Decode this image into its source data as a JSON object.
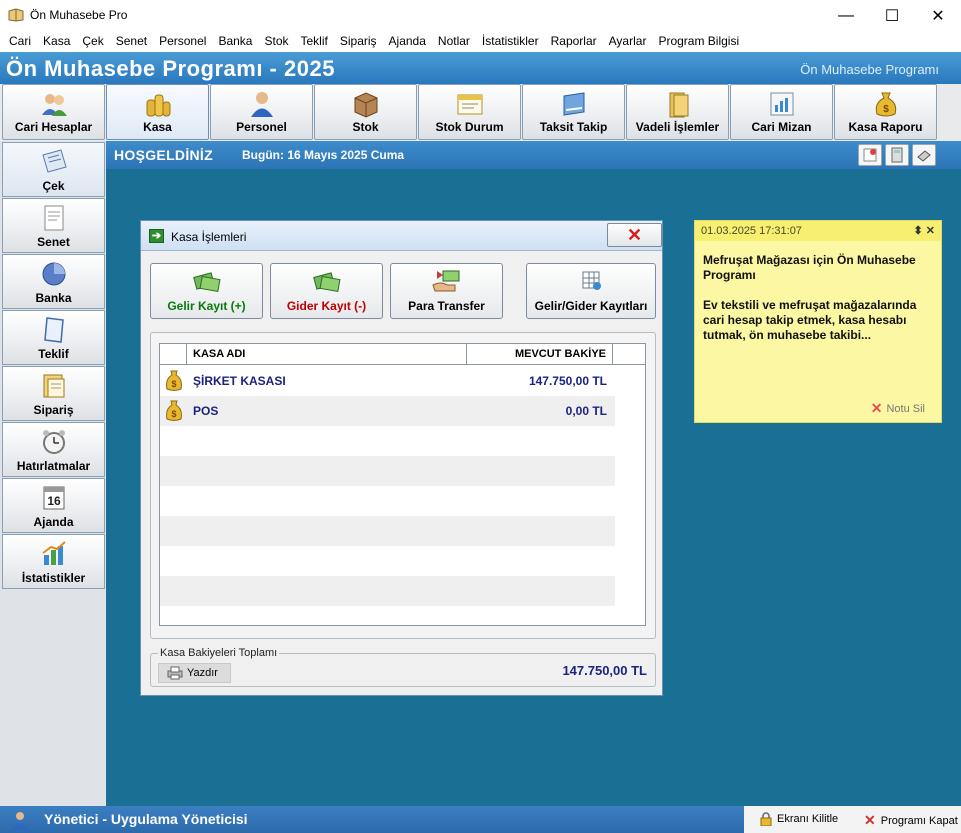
{
  "window": {
    "title": "Ön Muhasebe Pro",
    "controls": {
      "minimize": "—",
      "maximize": "☐",
      "close": "✕"
    }
  },
  "menu": [
    "Cari",
    "Kasa",
    "Çek",
    "Senet",
    "Personel",
    "Banka",
    "Stok",
    "Teklif",
    "Sipariş",
    "Ajanda",
    "Notlar",
    "İstatistikler",
    "Raporlar",
    "Ayarlar",
    "Program Bilgisi"
  ],
  "banner": {
    "title": "Ön Muhasebe Programı - 2025",
    "subtitle": "Ön Muhasebe Programı"
  },
  "toolbar": [
    {
      "label": "Cari Hesaplar",
      "icon": "users-icon"
    },
    {
      "label": "Kasa",
      "icon": "coins-icon"
    },
    {
      "label": "Personel",
      "icon": "person-icon"
    },
    {
      "label": "Stok",
      "icon": "box-icon"
    },
    {
      "label": "Stok Durum",
      "icon": "window-icon"
    },
    {
      "label": "Taksit Takip",
      "icon": "card-icon"
    },
    {
      "label": "Vadeli İşlemler",
      "icon": "folder-icon"
    },
    {
      "label": "Cari Mizan",
      "icon": "chart-icon"
    },
    {
      "label": "Kasa Raporu",
      "icon": "money-bag-icon"
    }
  ],
  "sidebar": [
    {
      "label": "Çek",
      "icon": "cheque-icon"
    },
    {
      "label": "Senet",
      "icon": "document-icon"
    },
    {
      "label": "Banka",
      "icon": "pie-icon"
    },
    {
      "label": "Teklif",
      "icon": "page-icon"
    },
    {
      "label": "Sipariş",
      "icon": "order-icon"
    },
    {
      "label": "Hatırlatmalar",
      "icon": "alarm-clock-icon"
    },
    {
      "label": "Ajanda",
      "icon": "calendar-icon",
      "day": "16"
    },
    {
      "label": "İstatistikler",
      "icon": "statistics-icon"
    }
  ],
  "welcome": {
    "hello": "HOŞGELDİNİZ",
    "today": "Bugün: 16 Mayıs 2025 Cuma"
  },
  "dialog": {
    "title": "Kasa İşlemleri",
    "buttons": [
      {
        "label": "Gelir Kayıt (+)",
        "color": "#0a7a0a",
        "icon": "money-icon"
      },
      {
        "label": "Gider Kayıt (-)",
        "color": "#c00000",
        "icon": "money-icon"
      },
      {
        "label": "Para Transfer",
        "color": "#000000",
        "icon": "transfer-icon"
      },
      {
        "label": "Gelir/Gider Kayıtları",
        "color": "#000000",
        "icon": "grid-icon"
      }
    ],
    "table": {
      "columns": [
        "KASA ADI",
        "MEVCUT BAKİYE"
      ],
      "rows": [
        {
          "name": "ŞİRKET KASASI",
          "balance": "147.750,00 TL"
        },
        {
          "name": "POS",
          "balance": "0,00 TL"
        }
      ]
    },
    "totals": {
      "legend": "Kasa Bakiyeleri Toplamı",
      "print_label": "Yazdır",
      "total": "147.750,00 TL"
    }
  },
  "note": {
    "timestamp": "01.03.2025 17:31:07",
    "body": "Mefruşat Mağazası için Ön Muhasebe Programı\n\nEv tekstili ve mefruşat mağazalarında cari hesap takip etmek, kasa hesabı tutmak, ön muhasebe takibi...",
    "delete_label": "Notu Sil"
  },
  "status": {
    "user": "Yönetici - Uygulama Yöneticisi",
    "lock_label": "Ekranı Kilitle",
    "quit_label": "Programı Kapat"
  }
}
